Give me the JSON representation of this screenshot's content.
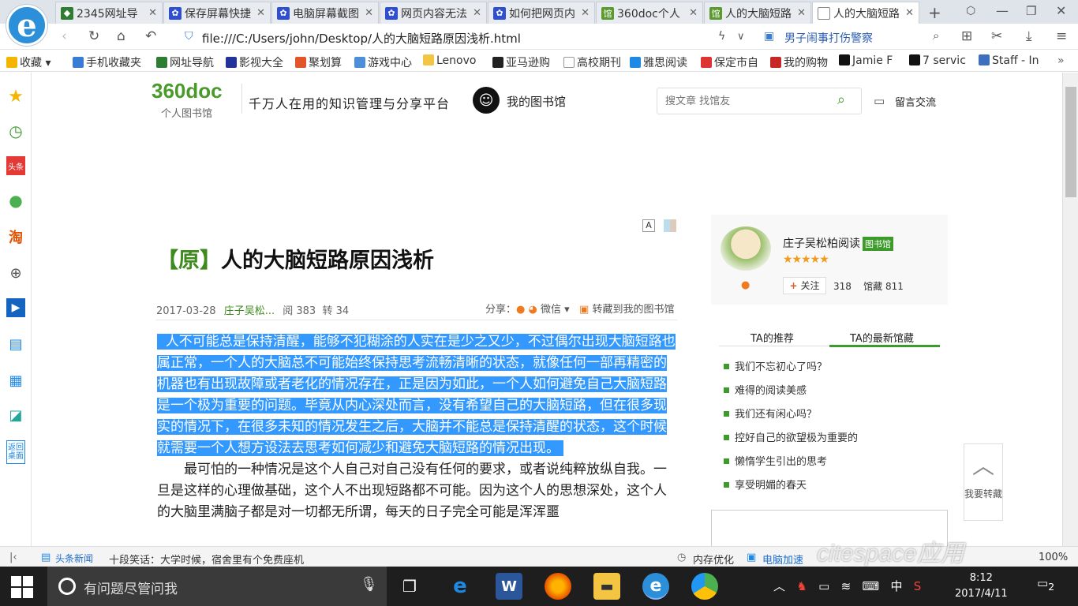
{
  "browser": {
    "tabs": [
      {
        "label": "2345网址导",
        "icon": "2345-icon",
        "color": "#2e7d32"
      },
      {
        "label": "保存屏幕快捷",
        "icon": "baidu-icon",
        "color": "#2f4fd0"
      },
      {
        "label": "电脑屏幕截图",
        "icon": "baidu-icon",
        "color": "#2f4fd0"
      },
      {
        "label": "网页内容无法",
        "icon": "baidu-icon",
        "color": "#2f4fd0"
      },
      {
        "label": "如何把网页内",
        "icon": "baidu-icon",
        "color": "#2f4fd0"
      },
      {
        "label": "360doc个人",
        "icon": "360doc-icon",
        "color": "#5b9a2e"
      },
      {
        "label": "人的大脑短路",
        "icon": "360doc-icon",
        "color": "#5b9a2e"
      },
      {
        "label": "人的大脑短路",
        "icon": "page-icon",
        "color": "#888888"
      }
    ],
    "url": "file:///C:/Users/john/Desktop/人的大脑短路原因浅析.html",
    "suggest": "男子闹事打伤警察",
    "bookmarks": [
      {
        "label": "收藏",
        "color": "#f5b400"
      },
      {
        "label": "手机收藏夹",
        "color": "#3a7bd5"
      },
      {
        "label": "网址导航",
        "color": "#2e7d32"
      },
      {
        "label": "影视大全",
        "color": "#223399"
      },
      {
        "label": "聚划算",
        "color": "#e2542a"
      },
      {
        "label": "游戏中心",
        "color": "#4a8fd8"
      },
      {
        "label": "Lenovo",
        "color": "#f4c542"
      },
      {
        "label": "亚马逊购",
        "color": "#222222"
      },
      {
        "label": "高校期刊",
        "color": "#888888"
      },
      {
        "label": "雅思阅读",
        "color": "#1e88e5"
      },
      {
        "label": "保定市自",
        "color": "#d33"
      },
      {
        "label": "我的购物",
        "color": "#c62828"
      },
      {
        "label": "Jamie F",
        "color": "#111111"
      },
      {
        "label": "7 servic",
        "color": "#111111"
      },
      {
        "label": "Staff - In",
        "color": "#3e6fbf"
      }
    ]
  },
  "sidebar": {
    "return_label": "返回桌面"
  },
  "site": {
    "logo": "360doc",
    "logo_sub": "个人图书馆",
    "slogan": "千万人在用的知识管理与分享平台",
    "my_library": "我的图书馆",
    "search_placeholder": "搜文章 找馆友",
    "message": "留言交流"
  },
  "article": {
    "font_btn": "A",
    "tag": "【原】",
    "title": "人的大脑短路原因浅析",
    "date": "2017-03-28",
    "author": "庄子吴松...",
    "reads": "阅 383",
    "reposts": "转 34",
    "share_label": "分享：",
    "wechat": "微信",
    "collect": "转藏到我的图书馆",
    "para1": "人不可能总是保持清醒，能够不犯糊涂的人实在是少之又少，不过偶尔出现大脑短路也属正常，一个人的大脑总不可能始终保持思考流畅清晰的状态，就像任何一部再精密的机器也有出现故障或者老化的情况存在，正是因为如此，一个人如何避免自己大脑短路是一个极为重要的问题。毕竟从内心深处而言，没有希望自己的大脑短路，但在很多现实的情况下，在很多未知的情况发生之后，大脑并不能总是保持清醒的状态，这个时候就需要一个人想方设法去思考如何减少和避免大脑短路的情况出现。",
    "para2": "最可怕的一种情况是这个人自己对自己没有任何的要求，或者说纯粹放纵自我。一旦是这样的心理做基础，这个人不出现短路都不可能。因为这个人的思想深处，这个人的大脑里满脑子都是对一切都无所谓，每天的日子完全可能是浑浑噩"
  },
  "profile": {
    "name": "庄子吴松柏阅读",
    "badge": "图书馆",
    "stars": "★★★★★",
    "follow": "关注",
    "follow_count": "318",
    "collect_count": "馆藏 811"
  },
  "right_tabs": {
    "tab1": "TA的推荐",
    "tab2": "TA的最新馆藏",
    "items": [
      "我们不忘初心了吗？",
      "难得的阅读美感",
      "我们还有闲心吗？",
      "控好自己的欲望极为重要的",
      "懒惰学生引出的思考",
      "享受明媚的春天"
    ]
  },
  "totop": "我要转藏",
  "statusbar": {
    "news_label": "头条新闻",
    "news_text": "十段笑话：大学时候，宿舍里有个免费座机",
    "mem": "内存优化",
    "speed": "电脑加速",
    "zoom": "100%"
  },
  "watermark": "citespace应用",
  "taskbar": {
    "search": "有问题尽管问我",
    "ime": "中",
    "time": "8:12",
    "date": "2017/4/11",
    "notif_count": "2"
  }
}
